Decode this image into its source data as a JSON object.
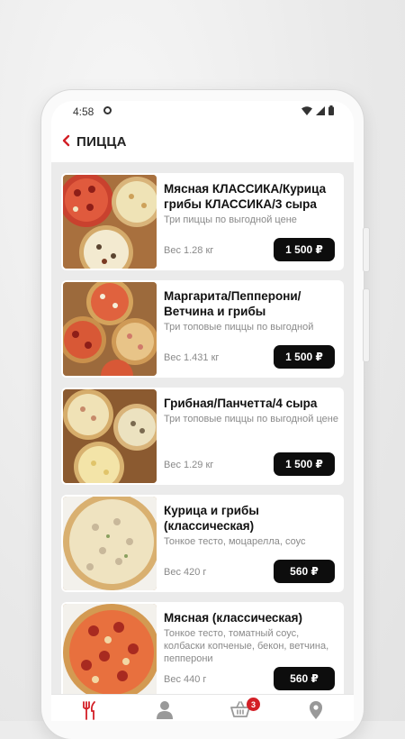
{
  "status_bar": {
    "time": "4:58"
  },
  "header": {
    "title": "ПИЦЦА"
  },
  "colors": {
    "accent": "#d31f26",
    "price_button": "#0d0d0d",
    "list_bg": "#ebebeb"
  },
  "products": [
    {
      "name": "Мясная КЛАССИКА/Курица грибы КЛАССИКА/3 сыра",
      "description": "Три пиццы по выгодной цене",
      "weight": "Вес 1.28 кг",
      "price": "1 500 ₽"
    },
    {
      "name": "Маргарита/Пепперони/ Ветчина и грибы",
      "description": "Три топовые пиццы по выгодной",
      "weight": "Вес 1.431 кг",
      "price": "1 500 ₽"
    },
    {
      "name": "Грибная/Панчетта/4 сыра",
      "description": "Три топовые пиццы по выгодной цене",
      "weight": "Вес 1.29 кг",
      "price": "1 500 ₽"
    },
    {
      "name": "Курица и грибы (классическая)",
      "description": "Тонкое тесто, моцарелла, соус",
      "weight": "Вес 420 г",
      "price": "560 ₽"
    },
    {
      "name": "Мясная  (классическая)",
      "description": "Тонкое тесто, томатный соус, колбаски копченые, бекон, ветчина, пепперони",
      "weight": "Вес 440 г",
      "price": "560 ₽"
    }
  ],
  "tab_bar": {
    "cart_count": "3",
    "active_tab": "menu",
    "icons": [
      "fork-knife-icon",
      "profile-icon",
      "cart-icon",
      "location-icon"
    ]
  }
}
